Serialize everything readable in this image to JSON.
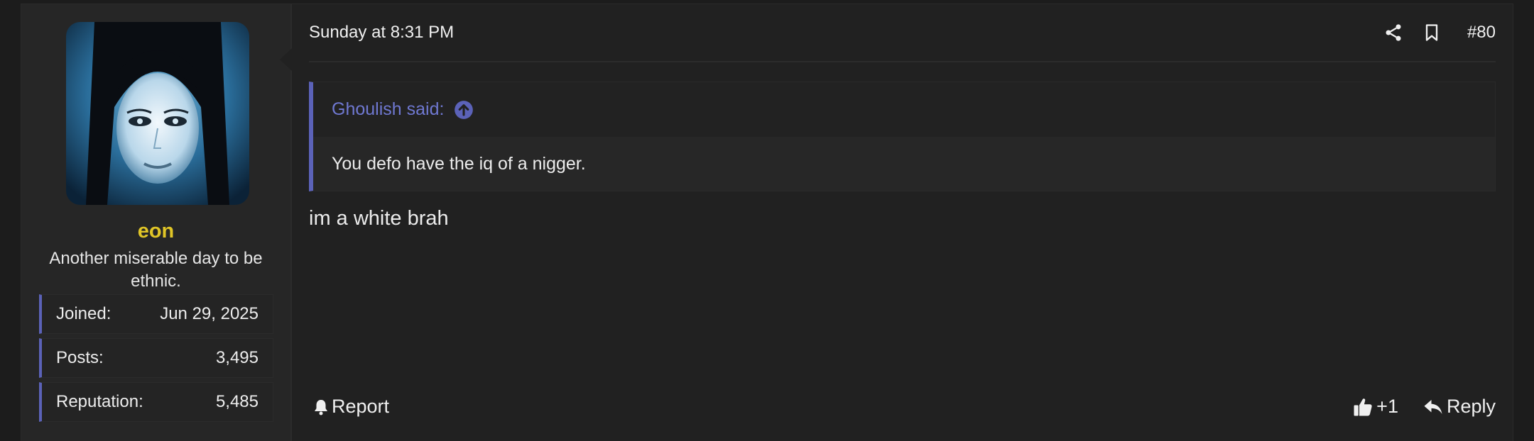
{
  "user": {
    "name": "eon",
    "title": "Another miserable day to be ethnic.",
    "name_color": "#e0c527",
    "avatar_icon": "avatar-portrait",
    "stats": [
      {
        "label": "Joined:",
        "value": "Jun 29, 2025"
      },
      {
        "label": "Posts:",
        "value": "3,495"
      },
      {
        "label": "Reputation:",
        "value": "5,485"
      }
    ]
  },
  "post": {
    "date": "Sunday at 8:31 PM",
    "number": "#80",
    "share_icon": "share-icon",
    "bookmark_icon": "bookmark-icon",
    "quote": {
      "author": "Ghoulish said:",
      "goto_icon": "arrow-up-circle-icon",
      "text": "You defo have the iq of a nigger."
    },
    "message": "im a white brah",
    "footer": {
      "report_label": "Report",
      "report_icon": "bell-icon",
      "reaction_label": "+1",
      "reaction_icon": "thumbs-up-icon",
      "reply_label": "Reply",
      "reply_icon": "reply-icon"
    }
  },
  "colors": {
    "accent": "#5b62b8",
    "link": "#6f78d1",
    "background": "#212121"
  }
}
